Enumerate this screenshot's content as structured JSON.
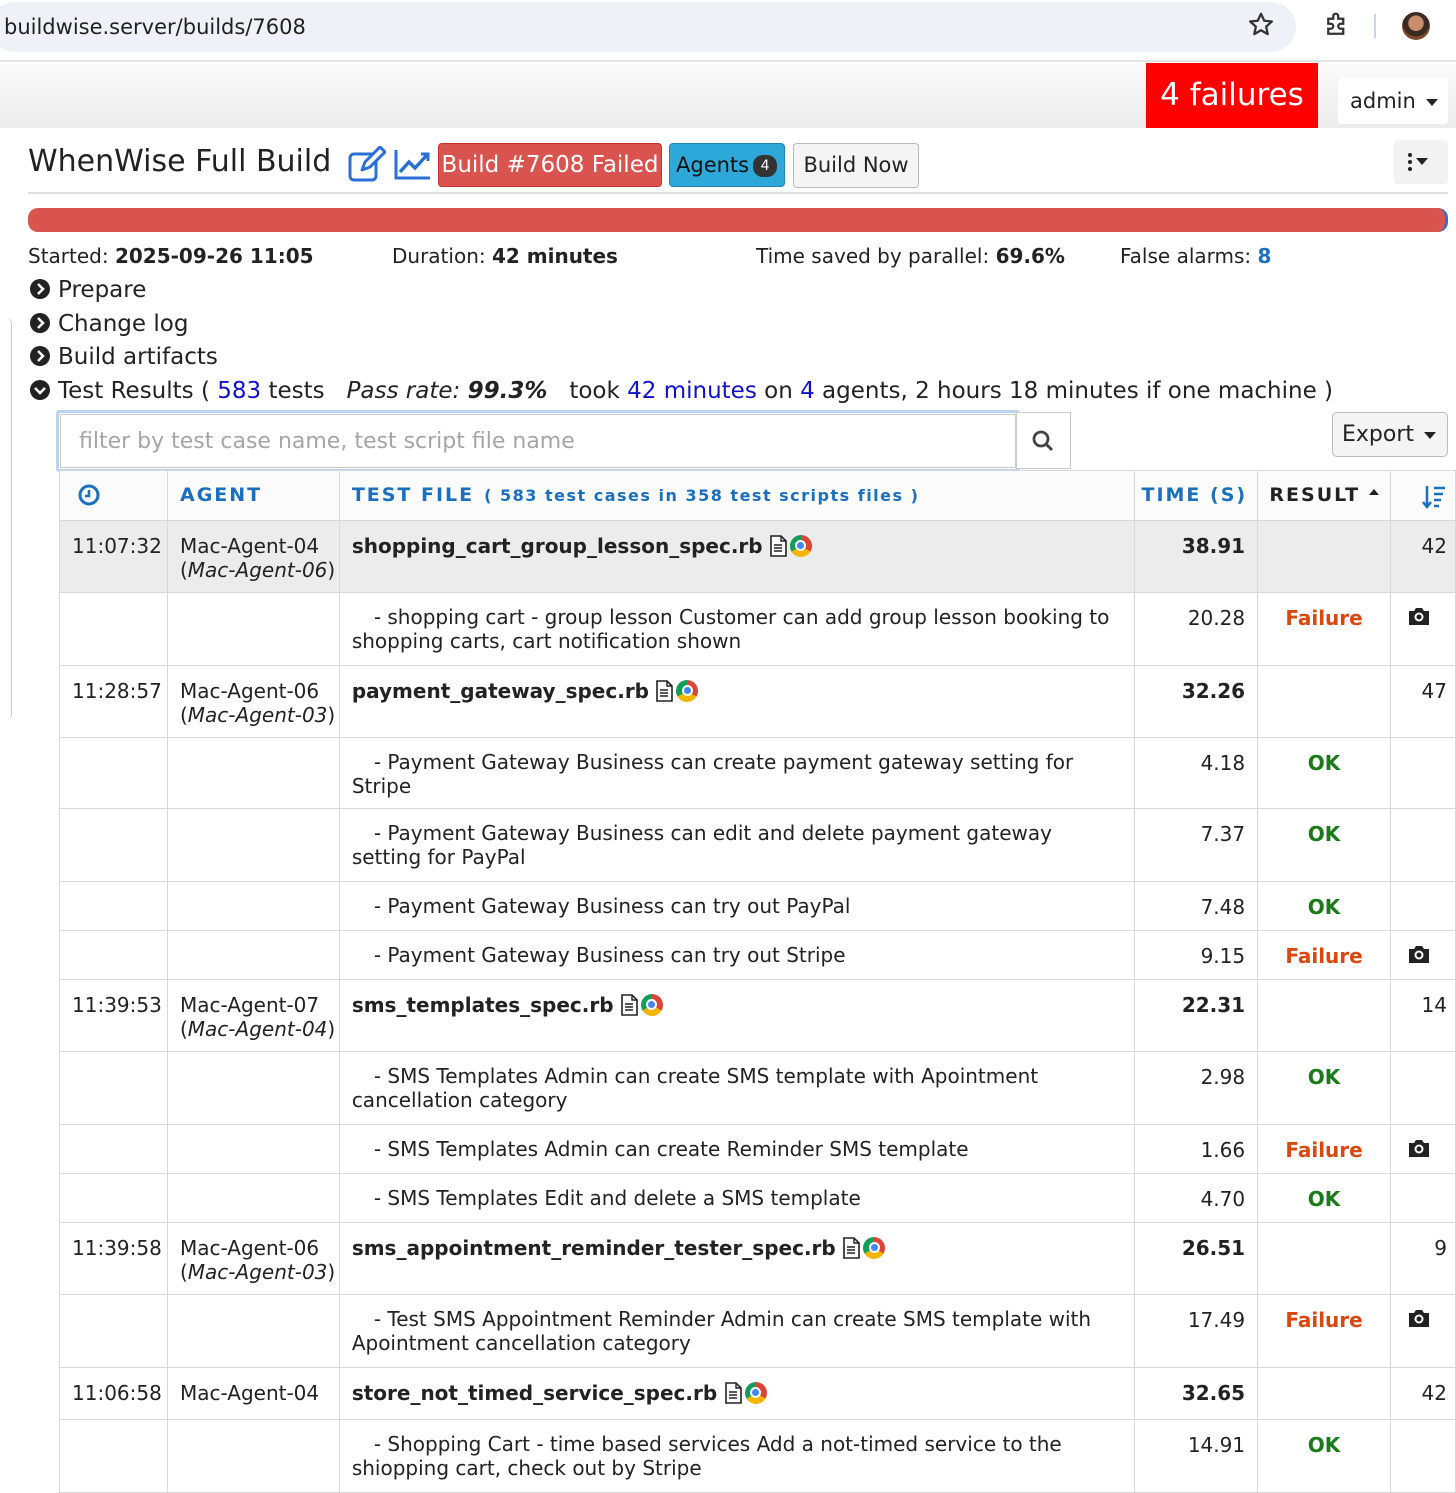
{
  "browser": {
    "url": "buildwise.server/builds/7608"
  },
  "topbar": {
    "failures_label": "4 failures",
    "user_menu": "admin"
  },
  "header": {
    "title": "WhenWise Full Build",
    "build_status": "Build #7608 Failed",
    "agents_label": "Agents",
    "agents_count": "4",
    "build_now": "Build Now"
  },
  "colors": {
    "failed": "#d9534f",
    "agents": "#2ea8d8",
    "failures_badge": "#ff0000",
    "ok": "#1a7a1a",
    "failure_text": "#d9480f"
  },
  "progress": {
    "failed_fraction": 1.0
  },
  "stats": {
    "started_label": "Started:",
    "started": "2025-09-26 11:05",
    "duration_label": "Duration:",
    "duration": "42 minutes",
    "saved_label": "Time saved by parallel:",
    "saved": "69.6%",
    "alarms_label": "False alarms:",
    "alarms": "8"
  },
  "sections": {
    "prepare": "Prepare",
    "changelog": "Change log",
    "artifacts": "Build artifacts",
    "results_label": "Test Results (",
    "tests_count": "583",
    "tests_word": "tests",
    "pass_rate_label": "Pass rate:",
    "pass_rate": "99.3%",
    "took": "took",
    "took_time": "42 minutes",
    "on": "on",
    "agents_n": "4",
    "tail": "agents, 2 hours 18 minutes if one machine )"
  },
  "filter": {
    "placeholder": "filter by test case name, test script file name"
  },
  "export_label": "Export",
  "table": {
    "headers": {
      "agent": "AGENT",
      "file": "TEST FILE",
      "file_sub": "( 583 test cases in 358 test scripts files )",
      "time": "TIME (S)",
      "result": "RESULT"
    },
    "groups": [
      {
        "time": "11:07:32",
        "agent": "Mac-Agent-04",
        "agent_alt": "Mac-Agent-06",
        "file": "shopping_cart_group_lesson_spec.rb",
        "duration": "38.91",
        "extra": "42",
        "cases": [
          {
            "text": "- shopping cart - group lesson Customer can add group lesson booking to shopping carts, cart notification shown",
            "duration": "20.28",
            "result": "Failure"
          }
        ]
      },
      {
        "time": "11:28:57",
        "agent": "Mac-Agent-06",
        "agent_alt": "Mac-Agent-03",
        "file": "payment_gateway_spec.rb",
        "duration": "32.26",
        "extra": "47",
        "cases": [
          {
            "text": "- Payment Gateway Business can create payment gateway setting for Stripe",
            "duration": "4.18",
            "result": "OK"
          },
          {
            "text": "- Payment Gateway Business can edit and delete payment gateway setting for PayPal",
            "duration": "7.37",
            "result": "OK"
          },
          {
            "text": "- Payment Gateway Business can try out PayPal",
            "duration": "7.48",
            "result": "OK"
          },
          {
            "text": "- Payment Gateway Business can try out Stripe",
            "duration": "9.15",
            "result": "Failure"
          }
        ]
      },
      {
        "time": "11:39:53",
        "agent": "Mac-Agent-07",
        "agent_alt": "Mac-Agent-04",
        "file": "sms_templates_spec.rb",
        "duration": "22.31",
        "extra": "14",
        "cases": [
          {
            "text": "- SMS Templates Admin can create SMS template with Apointment cancellation category",
            "duration": "2.98",
            "result": "OK"
          },
          {
            "text": "- SMS Templates Admin can create Reminder SMS template",
            "duration": "1.66",
            "result": "Failure"
          },
          {
            "text": "- SMS Templates Edit and delete a SMS template",
            "duration": "4.70",
            "result": "OK"
          }
        ]
      },
      {
        "time": "11:39:58",
        "agent": "Mac-Agent-06",
        "agent_alt": "Mac-Agent-03",
        "file": "sms_appointment_reminder_tester_spec.rb",
        "duration": "26.51",
        "extra": "9",
        "cases": [
          {
            "text": "- Test SMS Appointment Reminder Admin can create SMS template with Apointment cancellation category",
            "duration": "17.49",
            "result": "Failure"
          }
        ]
      },
      {
        "time": "11:06:58",
        "agent": "Mac-Agent-04",
        "agent_alt": "",
        "file": "store_not_timed_service_spec.rb",
        "duration": "32.65",
        "extra": "42",
        "cases": [
          {
            "text": "- Shopping Cart - time based services Add a not-timed service to the shiopping cart, check out by Stripe",
            "duration": "14.91",
            "result": "OK"
          }
        ]
      }
    ]
  }
}
